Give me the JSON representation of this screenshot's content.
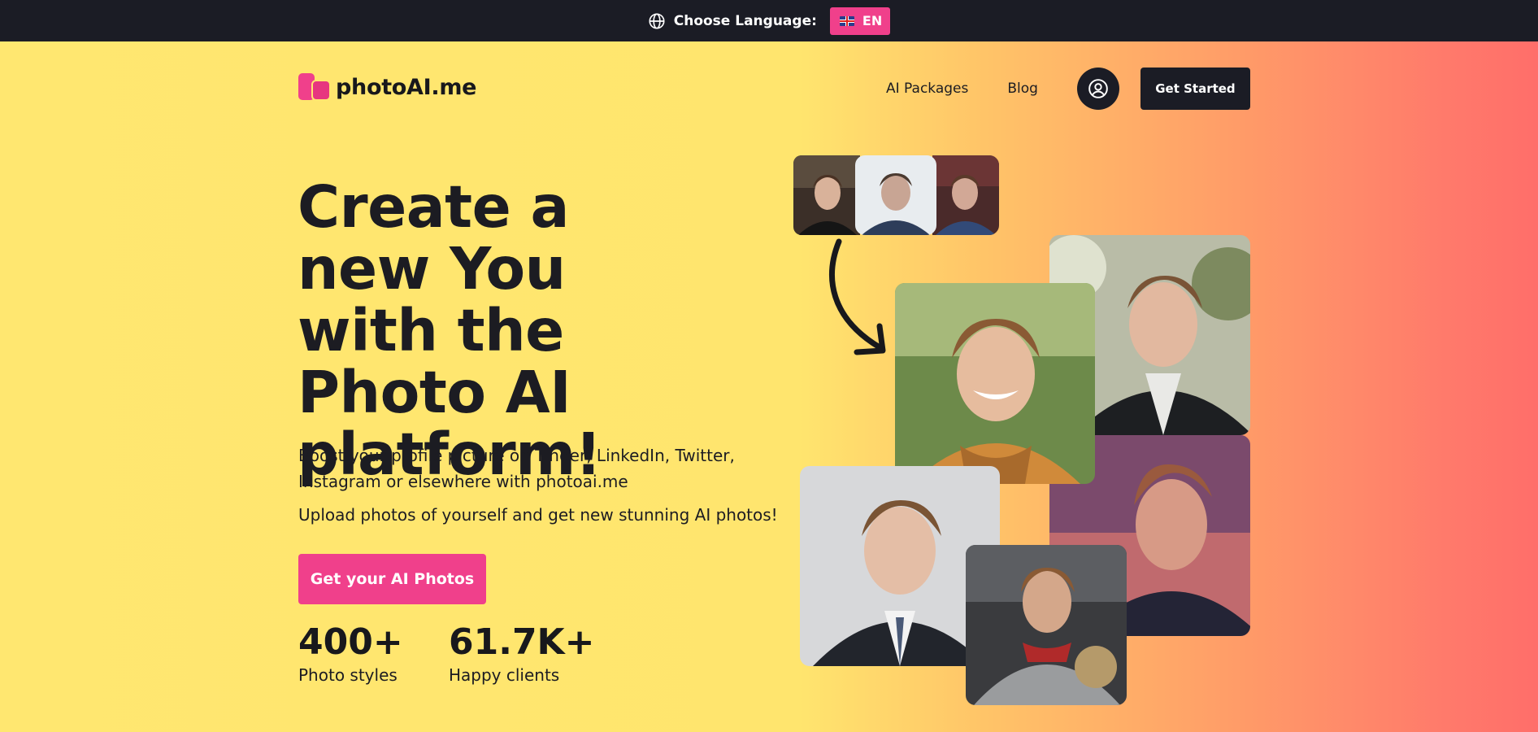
{
  "topbar": {
    "globe_icon": "globe-icon",
    "label": "Choose Language:",
    "language_code": "EN",
    "flag_icon": "uk-flag-icon"
  },
  "brand": {
    "name": "photoAI.me",
    "accent": "#f0408b"
  },
  "nav": {
    "packages": "AI Packages",
    "blog": "Blog",
    "account_icon": "user-circle-icon",
    "cta": "Get Started"
  },
  "hero": {
    "headline": "Create a new You with the Photo AI platform!",
    "subtitle": "Boost your profile picture on Tinder, LinkedIn, Twitter, Instagram or elsewhere with photoai.me",
    "subtitle2": "Upload photos of yourself and get new stunning AI photos!",
    "cta": "Get your AI Photos"
  },
  "stats": [
    {
      "value": "400+",
      "label": "Photo styles"
    },
    {
      "value": "61.7K+",
      "label": "Happy clients"
    }
  ],
  "colors": {
    "dark": "#1b1c25",
    "pink": "#f0408b",
    "yellow": "#ffe770",
    "coral": "#ff6e6a"
  }
}
